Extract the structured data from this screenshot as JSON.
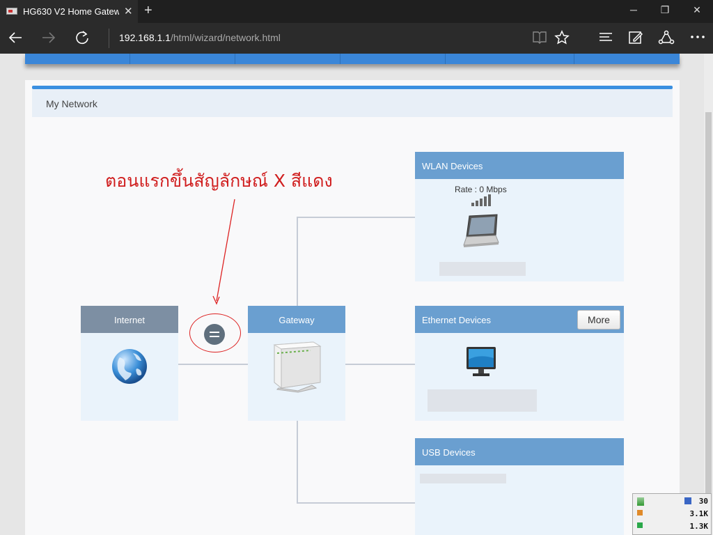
{
  "browser": {
    "tab_title": "HG630 V2 Home Gatew",
    "tab_close": "✕",
    "new_tab": "+",
    "url_host": "192.168.1.1",
    "url_path": "/html/wizard/network.html",
    "icons": [
      "back-icon",
      "forward-icon",
      "refresh-icon",
      "reading-view-icon",
      "favorite-star-icon",
      "hub-icon",
      "web-note-icon",
      "share-icon",
      "more-icon"
    ]
  },
  "window_controls": {
    "minimize": "─",
    "maximize": "❐",
    "close": "✕"
  },
  "panel": {
    "title": "My Network"
  },
  "annotation": {
    "text": "ตอนแรกขึ้นสัญลักษณ์ X สีแดง",
    "color": "#d01e1e"
  },
  "internet": {
    "label": "Internet"
  },
  "gateway": {
    "label": "Gateway"
  },
  "wlan": {
    "label": "WLAN Devices",
    "rate": "Rate : 0 Mbps"
  },
  "ethernet": {
    "label": "Ethernet Devices",
    "more_button": "More"
  },
  "usb": {
    "label": "USB Devices"
  },
  "tray": {
    "values": [
      "30",
      "3.1K",
      "1.3K"
    ]
  },
  "colors": {
    "header_blue": "#6a9fd0",
    "header_gray": "#7d8fa3",
    "accent_bar": "#3a86d8",
    "annotation_red": "#d01e1e"
  }
}
